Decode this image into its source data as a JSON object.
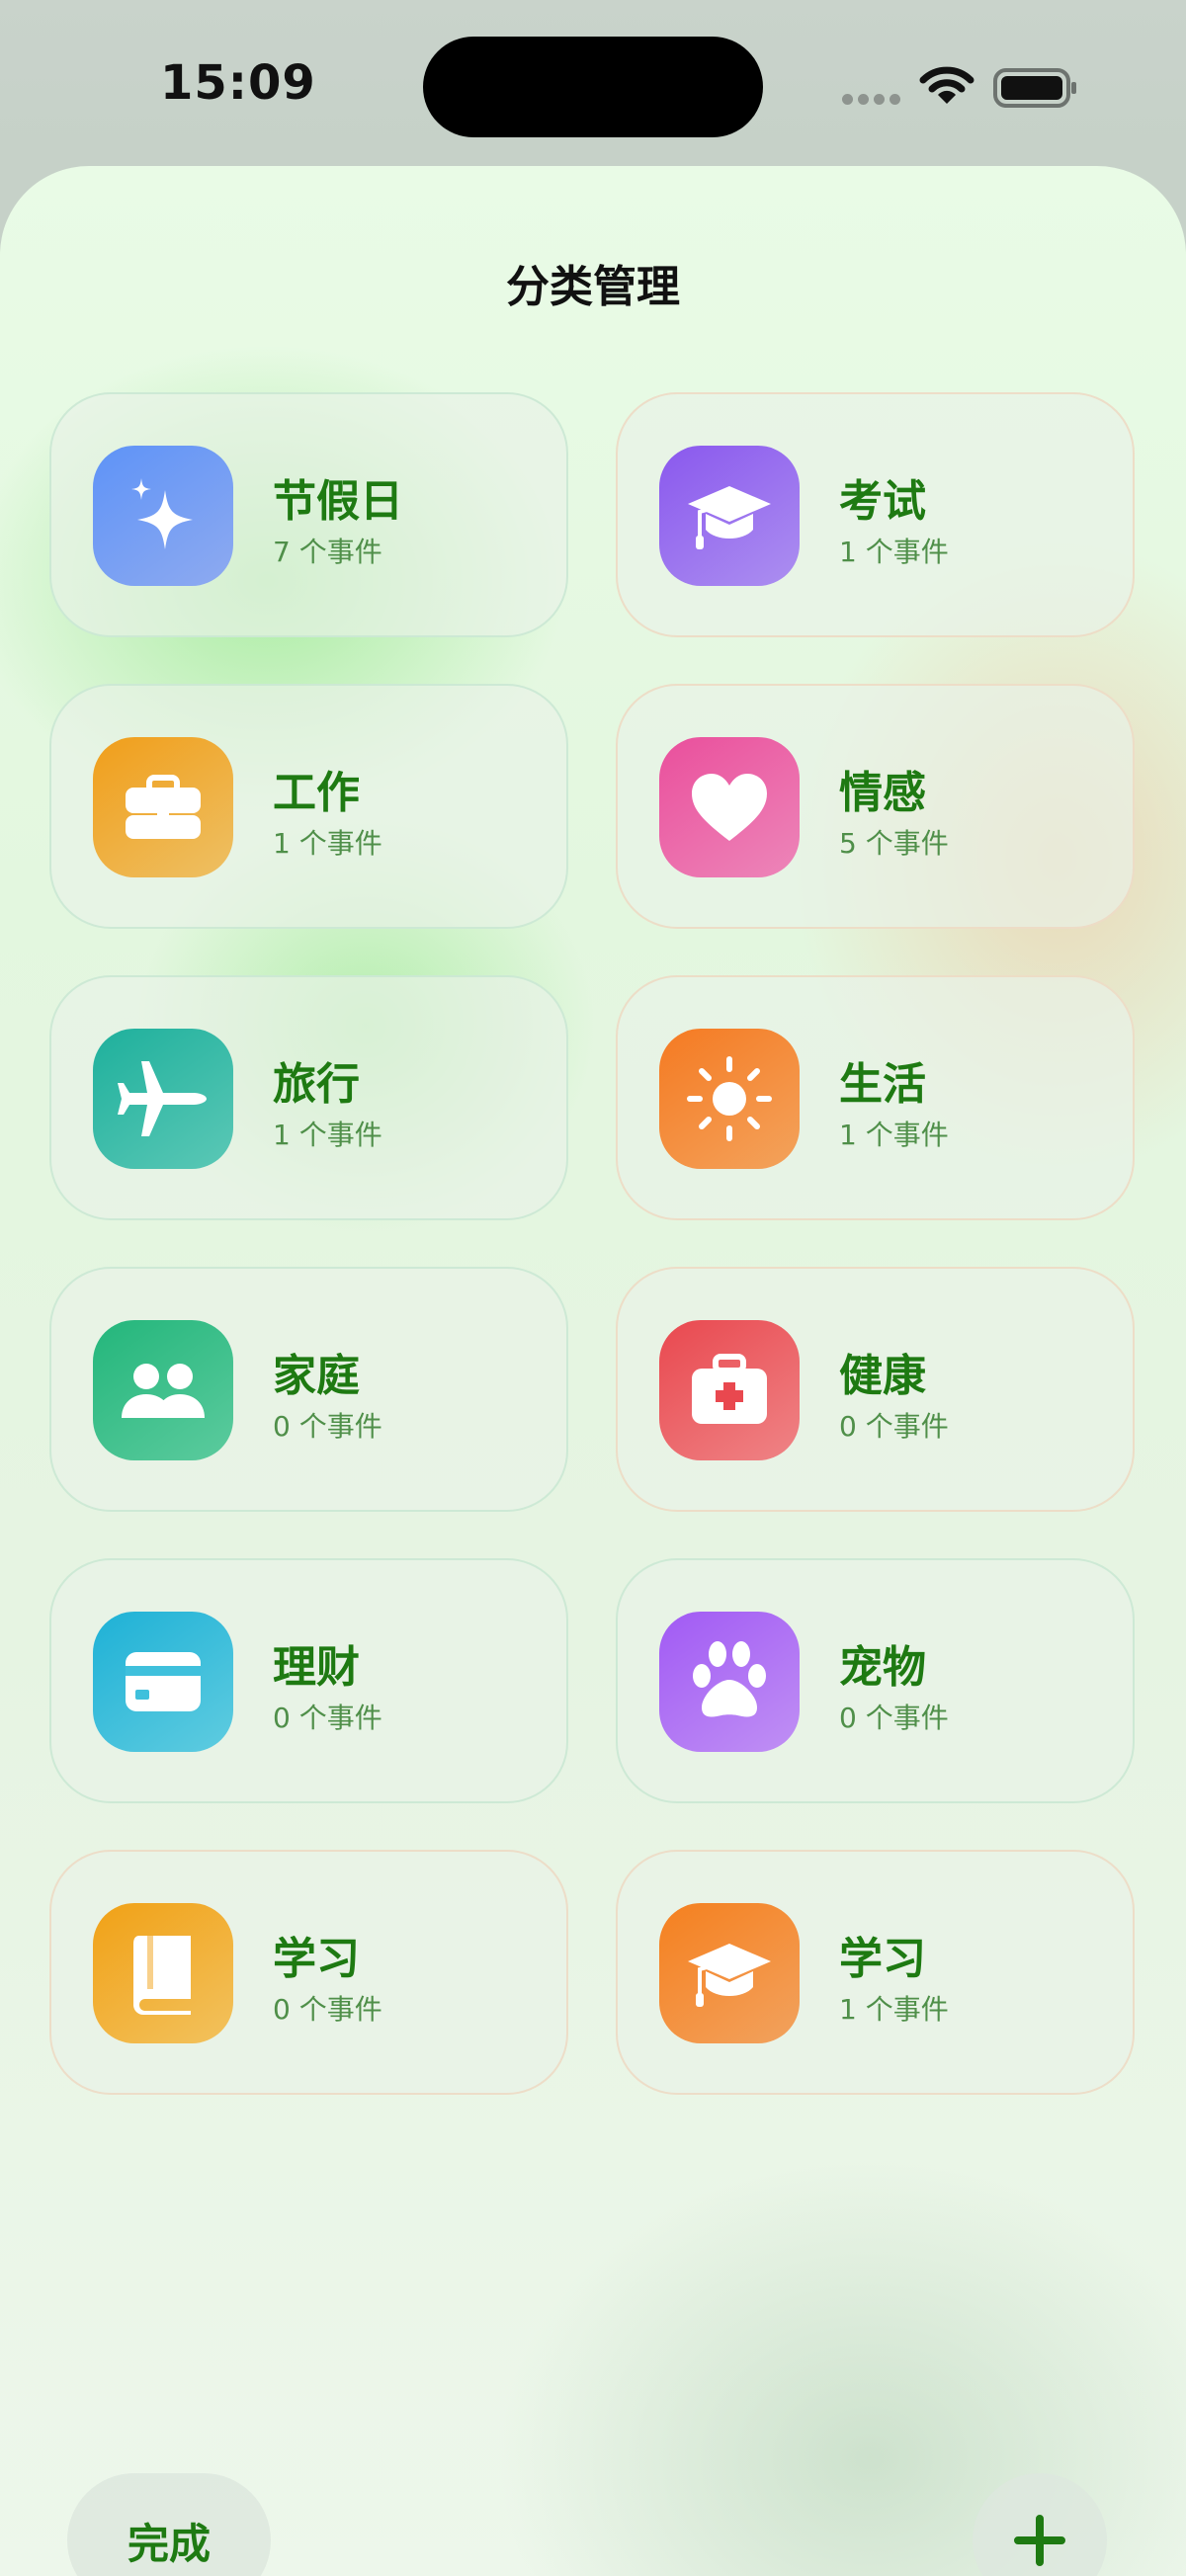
{
  "status_bar": {
    "time": "15:09"
  },
  "sheet": {
    "title": "分类管理"
  },
  "categories": [
    {
      "name": "节假日",
      "count": "7 个事件",
      "icon": "sparkles-icon",
      "colors": [
        "#5e93f7",
        "#8eaaf0"
      ]
    },
    {
      "name": "考试",
      "count": "1 个事件",
      "icon": "graduation-cap-icon",
      "colors": [
        "#8a58ee",
        "#ac8ff0"
      ]
    },
    {
      "name": "工作",
      "count": "1 个事件",
      "icon": "briefcase-icon",
      "colors": [
        "#f09e1a",
        "#eec064"
      ]
    },
    {
      "name": "情感",
      "count": "5 个事件",
      "icon": "heart-icon",
      "colors": [
        "#ea4f9c",
        "#ed86b9"
      ]
    },
    {
      "name": "旅行",
      "count": "1 个事件",
      "icon": "airplane-icon",
      "colors": [
        "#1eb09c",
        "#5bc8b6"
      ]
    },
    {
      "name": "生活",
      "count": "1 个事件",
      "icon": "sun-icon",
      "colors": [
        "#f57a22",
        "#f3a35c"
      ]
    },
    {
      "name": "家庭",
      "count": "0 个事件",
      "icon": "people-icon",
      "colors": [
        "#23b67b",
        "#5ccb9e"
      ]
    },
    {
      "name": "健康",
      "count": "0 个事件",
      "icon": "medical-kit-icon",
      "colors": [
        "#e9484f",
        "#ef8486"
      ]
    },
    {
      "name": "理财",
      "count": "0 个事件",
      "icon": "credit-card-icon",
      "colors": [
        "#1eb1d6",
        "#5fcce0"
      ]
    },
    {
      "name": "宠物",
      "count": "0 个事件",
      "icon": "paw-icon",
      "colors": [
        "#a15af4",
        "#c090f4"
      ]
    },
    {
      "name": "学习",
      "count": "0 个事件",
      "icon": "book-icon",
      "colors": [
        "#f1a116",
        "#f2c25e"
      ]
    },
    {
      "name": "学习",
      "count": "1 个事件",
      "icon": "graduation-cap-icon",
      "colors": [
        "#f5801f",
        "#f2a25e"
      ]
    }
  ],
  "footer": {
    "done_label": "完成",
    "add_icon": "plus-icon",
    "accent": "#1e7a12"
  }
}
